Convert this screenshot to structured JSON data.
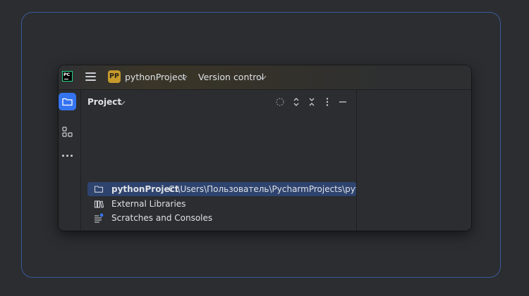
{
  "window": {
    "app_logo_text": "PC",
    "project_badge": "PP",
    "project_name": "pythonProject",
    "version_control_label": "Version control"
  },
  "sidebar": {
    "items": [
      {
        "icon": "folder-icon",
        "active": true
      },
      {
        "icon": "structure-icon",
        "active": false
      },
      {
        "icon": "more-icon",
        "active": false
      }
    ]
  },
  "project_panel": {
    "title": "Project",
    "toolbar_icons": [
      "locate-icon",
      "expand-all-icon",
      "collapse-all-icon",
      "options-icon",
      "hide-icon"
    ],
    "tree": [
      {
        "label": "pythonProject",
        "path": "C:\\Users\\Пользователь\\PycharmProjects\\python",
        "icon": "folder-icon",
        "selected": true
      },
      {
        "label": "External Libraries",
        "path": "",
        "icon": "library-icon",
        "selected": false
      },
      {
        "label": "Scratches and Consoles",
        "path": "",
        "icon": "scratches-icon",
        "selected": false
      }
    ]
  },
  "colors": {
    "accent": "#3574f0",
    "selection": "#2e436e",
    "background": "#2b2d30",
    "project_badge": "#c69a2c",
    "frame_border": "#3c5a9c"
  }
}
